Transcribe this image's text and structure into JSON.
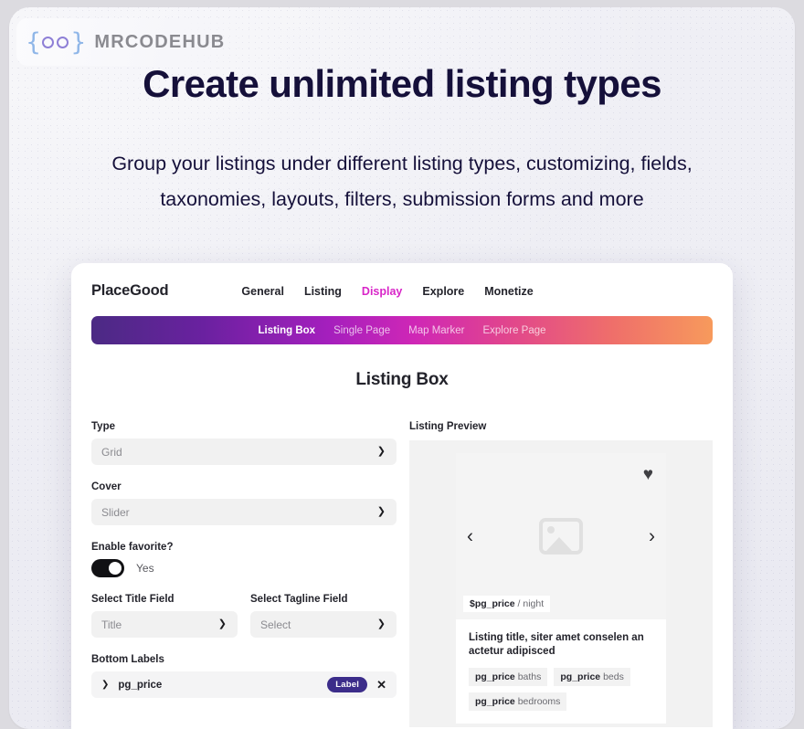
{
  "brand": {
    "mark": "{oo}",
    "name": "MRCODEHUB",
    "brace_left": "{",
    "brace_right": "}"
  },
  "hero": {
    "title": "Create unlimited listing types",
    "subtitle": "Group your listings under different listing types, customizing, fields, taxonomies, layouts, filters, submission forms and more"
  },
  "app": {
    "brand": "PlaceGood",
    "nav": [
      {
        "label": "General",
        "active": false
      },
      {
        "label": "Listing",
        "active": false
      },
      {
        "label": "Display",
        "active": true
      },
      {
        "label": "Explore",
        "active": false
      },
      {
        "label": "Monetize",
        "active": false
      }
    ],
    "subtabs": [
      {
        "label": "Listing Box",
        "active": true
      },
      {
        "label": "Single Page",
        "active": false
      },
      {
        "label": "Map Marker",
        "active": false
      },
      {
        "label": "Explore Page",
        "active": false
      }
    ],
    "panel_title": "Listing Box",
    "form": {
      "type": {
        "label": "Type",
        "value": "Grid"
      },
      "cover": {
        "label": "Cover",
        "value": "Slider"
      },
      "favorite": {
        "label": "Enable favorite?",
        "state": "Yes"
      },
      "title_field": {
        "label": "Select Title Field",
        "value": "Title"
      },
      "tagline_field": {
        "label": "Select Tagline Field",
        "value": "Select"
      },
      "bottom_labels": {
        "label": "Bottom Labels",
        "rows": [
          {
            "name": "pg_price",
            "badge": "Label",
            "remove": "✕"
          }
        ]
      }
    },
    "preview": {
      "label": "Listing Preview",
      "price_value": "$pg_price",
      "price_unit": "/ night",
      "title": "Listing title, siter amet conselen an actetur adipisced",
      "chips": [
        {
          "value": "pg_price",
          "unit": "baths"
        },
        {
          "value": "pg_price",
          "unit": "beds"
        },
        {
          "value": "pg_price",
          "unit": "bedrooms"
        }
      ]
    }
  },
  "icons": {
    "chevron_down": "⌄",
    "chevron_small": "⌄",
    "heart": "♥",
    "arrow_left": "‹",
    "arrow_right": "›"
  },
  "colors": {
    "accent_magenta": "#d826c8",
    "badge_purple": "#3c2d8a",
    "heading_navy": "#15103a",
    "gradient_start": "#4b2a84",
    "gradient_mid": "#cf27b6",
    "gradient_end": "#f79a5c"
  }
}
